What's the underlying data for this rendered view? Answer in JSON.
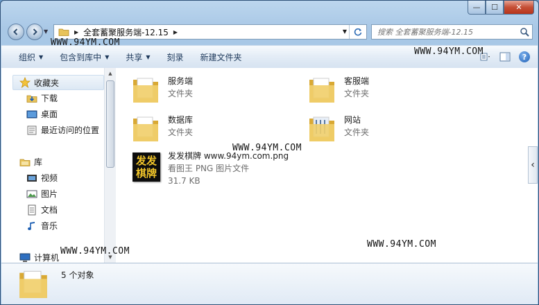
{
  "window": {
    "caption_buttons": {
      "minimize": "—",
      "maximize": "☐",
      "close": "✕"
    }
  },
  "address_bar": {
    "crumb": "全套蓄聚服务端-12.15",
    "refresh_icon": "refresh-icon"
  },
  "search": {
    "placeholder": "搜索 全套蓄聚服务端-12.15"
  },
  "toolbar": {
    "organize": "组织",
    "include_in_library": "包含到库中",
    "share": "共享",
    "burn": "刻录",
    "new_folder": "新建文件夹",
    "help": "?"
  },
  "nav_pane": {
    "favorites": "收藏夹",
    "downloads": "下载",
    "desktop": "桌面",
    "recent": "最近访问的位置",
    "libraries": "库",
    "videos": "视频",
    "pictures": "图片",
    "documents": "文档",
    "music": "音乐",
    "computer": "计算机"
  },
  "files": [
    {
      "name": "服务端",
      "type": "文件夹"
    },
    {
      "name": "客服端",
      "type": "文件夹"
    },
    {
      "name": "数据库",
      "type": "文件夹"
    },
    {
      "name": "网站",
      "type": "文件夹"
    },
    {
      "name": "发发棋牌 www.94ym.com.png",
      "type": "看图王 PNG 图片文件",
      "size": "31.7 KB",
      "thumb_text": "发发棋牌"
    }
  ],
  "watermark": "WWW.94YM.COM",
  "details": {
    "count": "5 个对象"
  },
  "colors": {
    "accent": "#1e395b",
    "folder": "#e8c35a",
    "close": "#c54f36"
  }
}
